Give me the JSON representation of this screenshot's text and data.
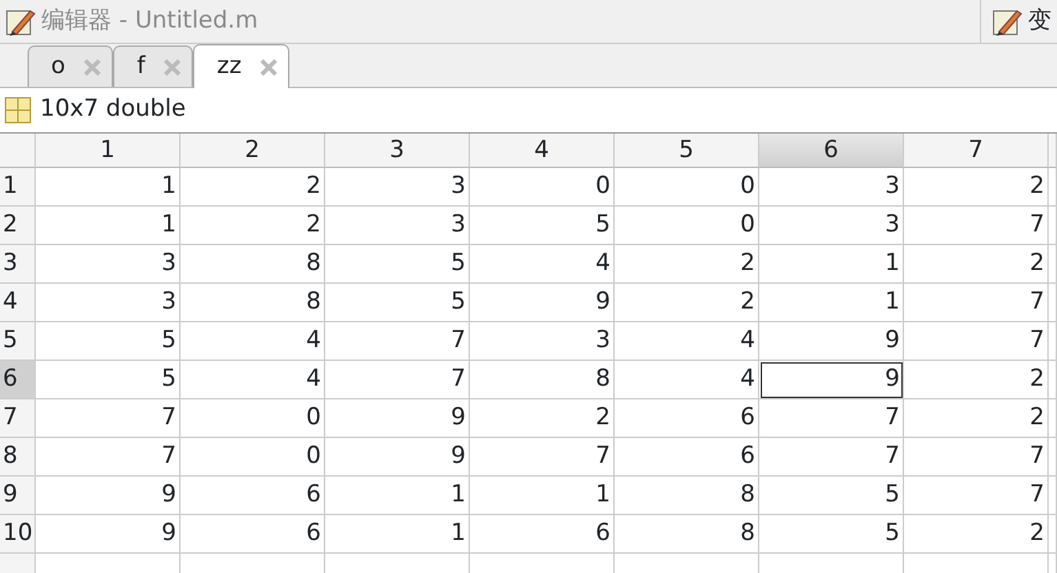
{
  "window": {
    "title": "编辑器 - Untitled.m",
    "right_title": "变"
  },
  "tabs": [
    {
      "label": "o",
      "selected": false
    },
    {
      "label": "f",
      "selected": false
    },
    {
      "label": "zz",
      "selected": true
    }
  ],
  "variable": {
    "summary": "10x7 double"
  },
  "table": {
    "columns": [
      {
        "label": "1",
        "selected": false
      },
      {
        "label": "2",
        "selected": false
      },
      {
        "label": "3",
        "selected": false
      },
      {
        "label": "4",
        "selected": false
      },
      {
        "label": "5",
        "selected": false
      },
      {
        "label": "6",
        "selected": true
      },
      {
        "label": "7",
        "selected": false
      }
    ],
    "rows": [
      {
        "label": "1",
        "selected": false,
        "cells": [
          "1",
          "2",
          "3",
          "0",
          "0",
          "3",
          "2"
        ]
      },
      {
        "label": "2",
        "selected": false,
        "cells": [
          "1",
          "2",
          "3",
          "5",
          "0",
          "3",
          "7"
        ]
      },
      {
        "label": "3",
        "selected": false,
        "cells": [
          "3",
          "8",
          "5",
          "4",
          "2",
          "1",
          "2"
        ]
      },
      {
        "label": "4",
        "selected": false,
        "cells": [
          "3",
          "8",
          "5",
          "9",
          "2",
          "1",
          "7"
        ]
      },
      {
        "label": "5",
        "selected": false,
        "cells": [
          "5",
          "4",
          "7",
          "3",
          "4",
          "9",
          "7"
        ]
      },
      {
        "label": "6",
        "selected": true,
        "cells": [
          "5",
          "4",
          "7",
          "8",
          "4",
          "9",
          "2"
        ]
      },
      {
        "label": "7",
        "selected": false,
        "cells": [
          "7",
          "0",
          "9",
          "2",
          "6",
          "7",
          "2"
        ]
      },
      {
        "label": "8",
        "selected": false,
        "cells": [
          "7",
          "0",
          "9",
          "7",
          "6",
          "7",
          "7"
        ]
      },
      {
        "label": "9",
        "selected": false,
        "cells": [
          "9",
          "6",
          "1",
          "1",
          "8",
          "5",
          "7"
        ]
      },
      {
        "label": "10",
        "selected": false,
        "cells": [
          "9",
          "6",
          "1",
          "6",
          "8",
          "5",
          "2"
        ]
      }
    ]
  }
}
